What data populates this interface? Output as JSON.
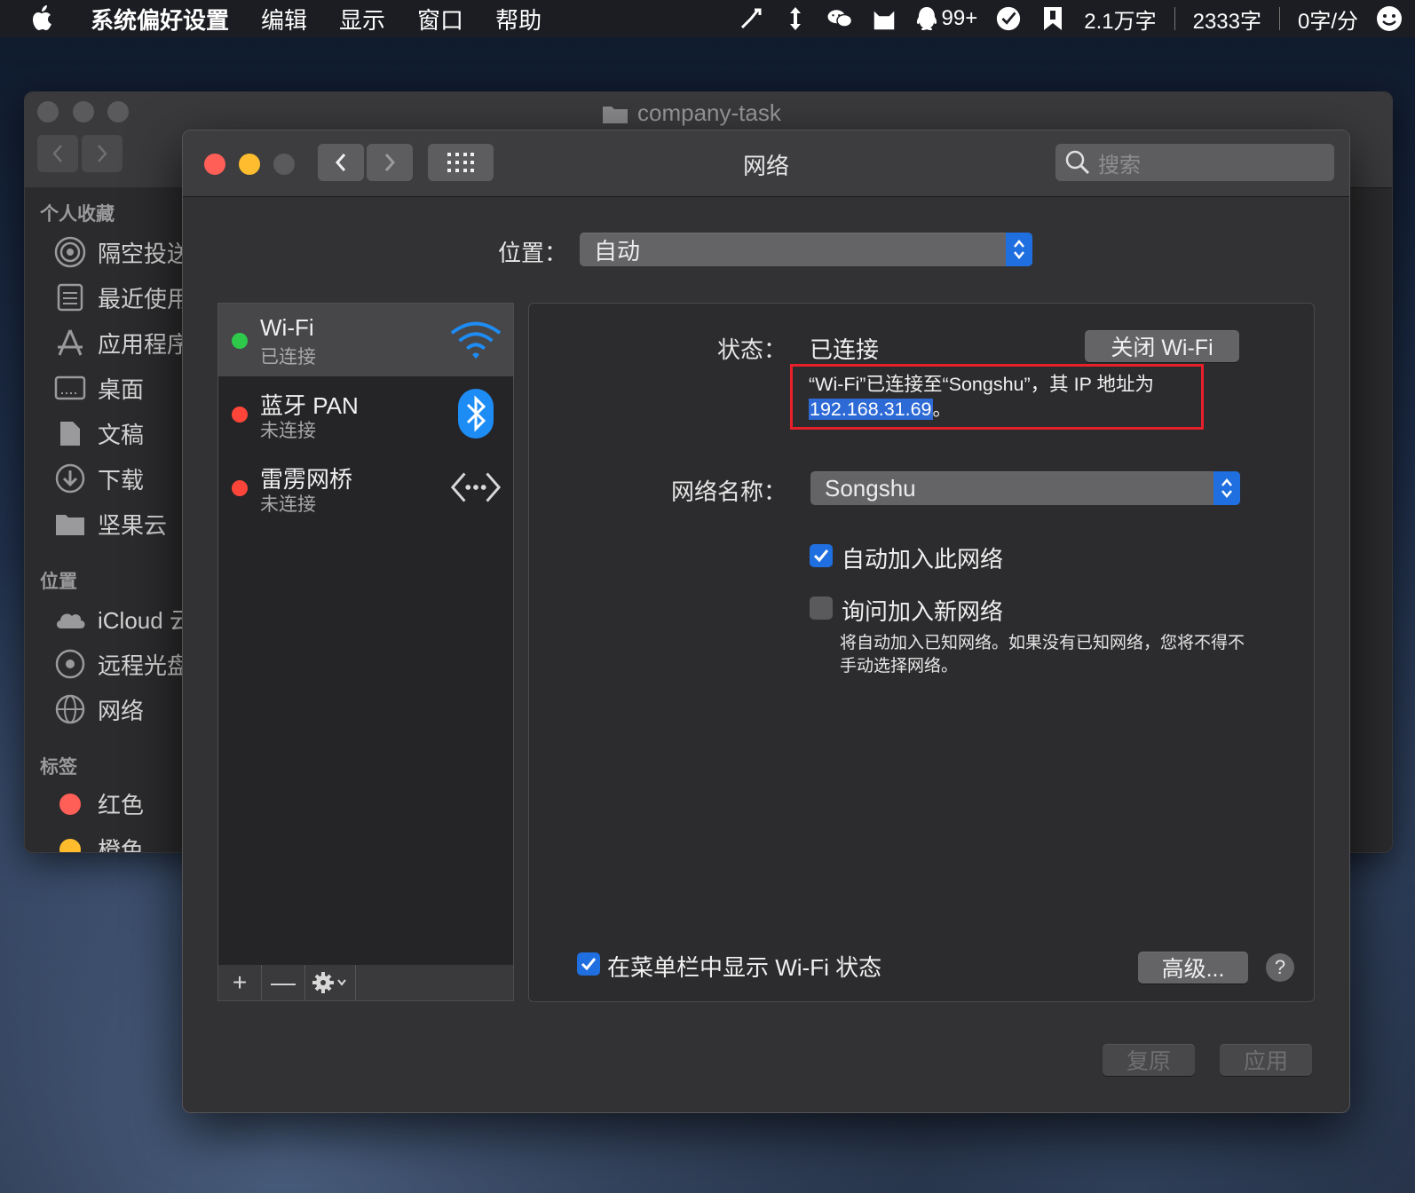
{
  "menubar": {
    "app_name": "系统偏好设置",
    "items": [
      "编辑",
      "显示",
      "窗口",
      "帮助"
    ],
    "status": {
      "qq_badge": "99+",
      "word_count_1": "2.1万字",
      "word_count_2": "2333字",
      "word_count_3": "0字/分"
    }
  },
  "finder": {
    "title": "company-task",
    "sections": {
      "favorites": "个人收藏",
      "locations": "位置",
      "tags": "标签"
    },
    "favorites": [
      {
        "label": "隔空投送",
        "icon": "airdrop-icon"
      },
      {
        "label": "最近使用",
        "icon": "recents-icon"
      },
      {
        "label": "应用程序",
        "icon": "applications-icon"
      },
      {
        "label": "桌面",
        "icon": "desktop-icon"
      },
      {
        "label": "文稿",
        "icon": "documents-icon"
      },
      {
        "label": "下载",
        "icon": "downloads-icon"
      },
      {
        "label": "坚果云",
        "icon": "folder-icon"
      }
    ],
    "locations": [
      {
        "label": "iCloud 云盘",
        "icon": "icloud-icon"
      },
      {
        "label": "远程光盘",
        "icon": "remote-disc-icon"
      },
      {
        "label": "网络",
        "icon": "network-icon"
      }
    ],
    "tags": [
      {
        "label": "红色",
        "color": "#ff5f57"
      },
      {
        "label": "橙色",
        "color": "#ffbd2e"
      }
    ]
  },
  "prefs": {
    "title": "网络",
    "search_placeholder": "搜索",
    "location_label": "位置：",
    "location_value": "自动",
    "services": [
      {
        "name": "Wi-Fi",
        "status": "已连接",
        "dot": "#2ec84a",
        "icon": "wifi-icon"
      },
      {
        "name": "蓝牙 PAN",
        "status": "未连接",
        "dot": "#ff453a",
        "icon": "bluetooth-icon"
      },
      {
        "name": "雷雳网桥",
        "status": "未连接",
        "dot": "#ff453a",
        "icon": "thunderbolt-bridge-icon"
      }
    ],
    "list_tools": {
      "add": "+",
      "remove": "—"
    },
    "detail": {
      "status_label": "状态：",
      "status_value": "已连接",
      "turn_off_button": "关闭 Wi-Fi",
      "info_line1": "“Wi-Fi”已连接至“Songshu”，其 IP 地址为",
      "ip_address": "192.168.31.69",
      "info_suffix": "。",
      "network_name_label": "网络名称：",
      "network_name_value": "Songshu",
      "auto_join_label": "自动加入此网络",
      "auto_join_checked": true,
      "ask_join_label": "询问加入新网络",
      "ask_join_checked": false,
      "help_text": "将自动加入已知网络。如果没有已知网络，您将不得不手动选择网络。",
      "show_in_menubar_label": "在菜单栏中显示 Wi-Fi 状态",
      "show_in_menubar_checked": true,
      "advanced_button": "高级...",
      "help_button": "?"
    },
    "revert_button": "复原",
    "apply_button": "应用"
  }
}
